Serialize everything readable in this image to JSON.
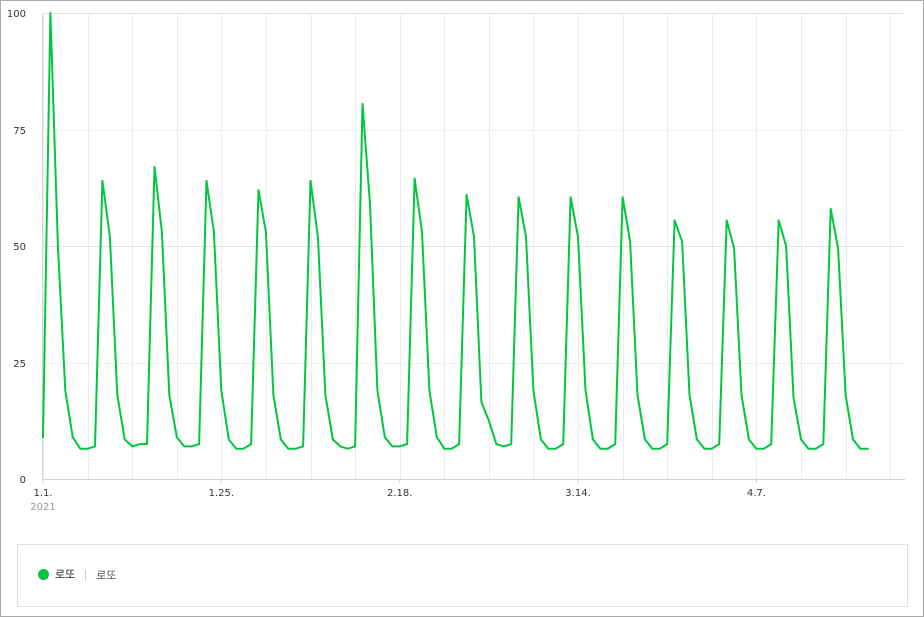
{
  "chart_data": {
    "type": "line",
    "x": [
      "2021-01-01",
      "2021-01-02",
      "2021-01-03",
      "2021-01-04",
      "2021-01-05",
      "2021-01-06",
      "2021-01-07",
      "2021-01-08",
      "2021-01-09",
      "2021-01-10",
      "2021-01-11",
      "2021-01-12",
      "2021-01-13",
      "2021-01-14",
      "2021-01-15",
      "2021-01-16",
      "2021-01-17",
      "2021-01-18",
      "2021-01-19",
      "2021-01-20",
      "2021-01-21",
      "2021-01-22",
      "2021-01-23",
      "2021-01-24",
      "2021-01-25",
      "2021-01-26",
      "2021-01-27",
      "2021-01-28",
      "2021-01-29",
      "2021-01-30",
      "2021-01-31",
      "2021-02-01",
      "2021-02-02",
      "2021-02-03",
      "2021-02-04",
      "2021-02-05",
      "2021-02-06",
      "2021-02-07",
      "2021-02-08",
      "2021-02-09",
      "2021-02-10",
      "2021-02-11",
      "2021-02-12",
      "2021-02-13",
      "2021-02-14",
      "2021-02-15",
      "2021-02-16",
      "2021-02-17",
      "2021-02-18",
      "2021-02-19",
      "2021-02-20",
      "2021-02-21",
      "2021-02-22",
      "2021-02-23",
      "2021-02-24",
      "2021-02-25",
      "2021-02-26",
      "2021-02-27",
      "2021-02-28",
      "2021-03-01",
      "2021-03-02",
      "2021-03-03",
      "2021-03-04",
      "2021-03-05",
      "2021-03-06",
      "2021-03-07",
      "2021-03-08",
      "2021-03-09",
      "2021-03-10",
      "2021-03-11",
      "2021-03-12",
      "2021-03-13",
      "2021-03-14",
      "2021-03-15",
      "2021-03-16",
      "2021-03-17",
      "2021-03-18",
      "2021-03-19",
      "2021-03-20",
      "2021-03-21",
      "2021-03-22",
      "2021-03-23",
      "2021-03-24",
      "2021-03-25",
      "2021-03-26",
      "2021-03-27",
      "2021-03-28",
      "2021-03-29",
      "2021-03-30",
      "2021-03-31",
      "2021-04-01",
      "2021-04-02",
      "2021-04-03",
      "2021-04-04",
      "2021-04-05",
      "2021-04-06",
      "2021-04-07",
      "2021-04-08",
      "2021-04-09",
      "2021-04-10",
      "2021-04-11",
      "2021-04-12",
      "2021-04-13",
      "2021-04-14",
      "2021-04-15",
      "2021-04-16",
      "2021-04-17",
      "2021-04-18",
      "2021-04-19",
      "2021-04-20",
      "2021-04-21",
      "2021-04-22",
      "2021-04-23",
      "2021-04-24",
      "2021-04-25",
      "2021-04-26",
      "2021-04-27"
    ],
    "series": [
      {
        "name": "로또",
        "color": "#00c73c",
        "values": [
          9,
          100,
          50,
          19,
          9,
          6.5,
          6.5,
          7,
          64,
          52,
          18,
          8.5,
          7,
          7.5,
          7.5,
          67,
          53,
          18,
          9,
          7,
          7,
          7.5,
          64,
          53,
          19,
          8.5,
          6.5,
          6.5,
          7.5,
          62,
          53,
          18,
          8.5,
          6.5,
          6.5,
          7,
          64,
          52,
          18,
          8.5,
          7,
          6.5,
          7,
          80.5,
          59,
          19,
          9,
          7,
          7,
          7.5,
          64.5,
          53,
          19,
          9,
          6.5,
          6.5,
          7.5,
          61,
          52,
          16.5,
          12.5,
          7.5,
          7,
          7.5,
          60.5,
          52,
          19,
          8.5,
          6.5,
          6.5,
          7.5,
          60.5,
          52,
          19,
          8.5,
          6.5,
          6.5,
          7.5,
          60.5,
          51,
          18,
          8.5,
          6.5,
          6.5,
          7.5,
          55.5,
          51,
          18,
          8.5,
          6.5,
          6.5,
          7.5,
          55.5,
          49.5,
          18,
          8.5,
          6.5,
          6.5,
          7.5,
          55.5,
          50,
          17.5,
          8.5,
          6.5,
          6.5,
          7.5,
          58,
          49.5,
          18,
          8.5,
          6.5,
          6.5
        ]
      }
    ],
    "ylim": [
      0,
      100
    ],
    "yticks": [
      "0",
      "25",
      "50",
      "75",
      "100"
    ],
    "xtick_labels": [
      "1.1.",
      "1.25.",
      "2.18.",
      "3.14.",
      "4.7."
    ],
    "xtick_sublabel": "2021",
    "grid": true,
    "legend": {
      "label": "로또",
      "term": "로또",
      "placement": "bottom"
    }
  }
}
